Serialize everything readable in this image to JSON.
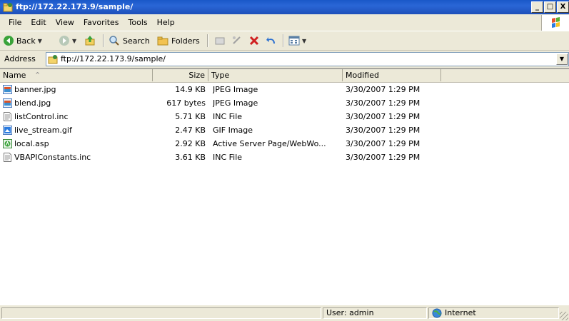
{
  "window": {
    "title": "ftp://172.22.173.9/sample/",
    "controls": {
      "minimize": "_",
      "maximize": "□",
      "close": "X"
    }
  },
  "menu": {
    "items": [
      "File",
      "Edit",
      "View",
      "Favorites",
      "Tools",
      "Help"
    ]
  },
  "toolbar": {
    "back_label": "Back",
    "search_label": "Search",
    "folders_label": "Folders"
  },
  "address": {
    "label": "Address",
    "value": "ftp://172.22.173.9/sample/"
  },
  "list": {
    "columns": [
      "Name",
      "Size",
      "Type",
      "Modified"
    ],
    "rows": [
      {
        "name": "banner.jpg",
        "size": "14.9 KB",
        "type": "JPEG Image",
        "modified": "3/30/2007 1:29 PM",
        "icon": "jpeg-file-icon"
      },
      {
        "name": "blend.jpg",
        "size": "617 bytes",
        "type": "JPEG Image",
        "modified": "3/30/2007 1:29 PM",
        "icon": "jpeg-file-icon"
      },
      {
        "name": "listControl.inc",
        "size": "5.71 KB",
        "type": "INC File",
        "modified": "3/30/2007 1:29 PM",
        "icon": "text-file-icon"
      },
      {
        "name": "live_stream.gif",
        "size": "2.47 KB",
        "type": "GIF Image",
        "modified": "3/30/2007 1:29 PM",
        "icon": "gif-file-icon"
      },
      {
        "name": "local.asp",
        "size": "2.92 KB",
        "type": "Active Server Page/WebWo...",
        "modified": "3/30/2007 1:29 PM",
        "icon": "asp-file-icon"
      },
      {
        "name": "VBAPIConstants.inc",
        "size": "3.61 KB",
        "type": "INC File",
        "modified": "3/30/2007 1:29 PM",
        "icon": "text-file-icon"
      }
    ]
  },
  "status": {
    "user": "User: admin",
    "zone": "Internet"
  },
  "colors": {
    "titlebar": "#1d4fb9",
    "chrome": "#ece9d8"
  }
}
